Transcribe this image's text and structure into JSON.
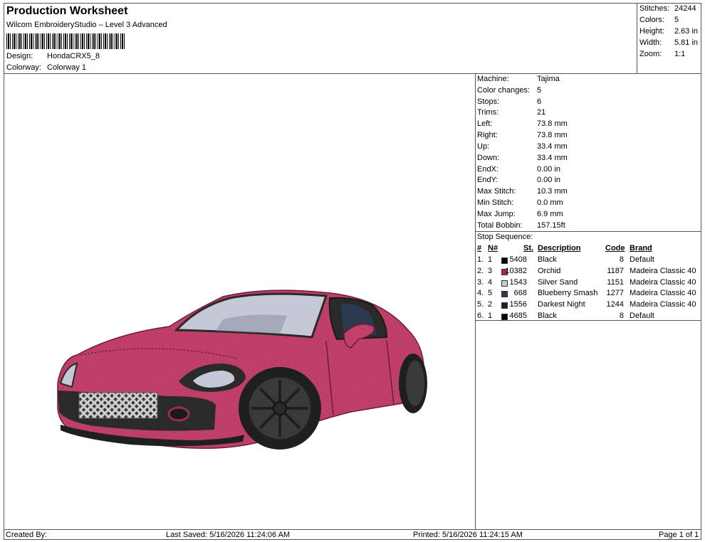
{
  "header": {
    "title": "Production Worksheet",
    "subtitle": "Wilcom EmbroideryStudio – Level 3 Advanced",
    "design_label": "Design:",
    "design_value": "HondaCRX5_8",
    "colorway_label": "Colorway:",
    "colorway_value": "Colorway 1"
  },
  "stats": [
    {
      "label": "Stitches:",
      "value": "24244"
    },
    {
      "label": "Colors:",
      "value": "5"
    },
    {
      "label": "Height:",
      "value": "2.63 in"
    },
    {
      "label": "Width:",
      "value": "5.81 in"
    },
    {
      "label": "Zoom:",
      "value": "1:1"
    }
  ],
  "machine": [
    {
      "label": "Machine:",
      "value": "Tajima"
    },
    {
      "label": "Color changes:",
      "value": "5"
    },
    {
      "label": "Stops:",
      "value": "6"
    },
    {
      "label": "Trims:",
      "value": "21"
    },
    {
      "label": "Left:",
      "value": "73.8 mm"
    },
    {
      "label": "Right:",
      "value": "73.8 mm"
    },
    {
      "label": "Up:",
      "value": "33.4 mm"
    },
    {
      "label": "Down:",
      "value": "33.4 mm"
    },
    {
      "label": "EndX:",
      "value": "0.00 in"
    },
    {
      "label": "EndY:",
      "value": "0.00 in"
    },
    {
      "label": "Max Stitch:",
      "value": "10.3 mm"
    },
    {
      "label": "Min Stitch:",
      "value": "0.0 mm"
    },
    {
      "label": "Max Jump:",
      "value": "6.9 mm"
    },
    {
      "label": "Total Bobbin:",
      "value": "157.15ft"
    }
  ],
  "stop_sequence": {
    "title": "Stop Sequence:",
    "headers": {
      "num": "#",
      "n": "N#",
      "st": "St.",
      "desc": "Description",
      "code": "Code",
      "brand": "Brand"
    },
    "rows": [
      {
        "num": "1.",
        "n": "1",
        "color": "#000000",
        "st": "5408",
        "desc": "Black",
        "code": "8",
        "brand": "Default"
      },
      {
        "num": "2.",
        "n": "3",
        "color": "#b2244f",
        "st": "10382",
        "desc": "Orchid",
        "code": "1187",
        "brand": "Madeira Classic 40"
      },
      {
        "num": "3.",
        "n": "4",
        "color": "#c5c8d6",
        "st": "1543",
        "desc": "Silver Sand",
        "code": "1151",
        "brand": "Madeira Classic 40"
      },
      {
        "num": "4.",
        "n": "5",
        "color": "#2a3a4f",
        "st": "668",
        "desc": "Blueberry Smash",
        "code": "1277",
        "brand": "Madeira Classic 40"
      },
      {
        "num": "5.",
        "n": "2",
        "color": "#222222",
        "st": "1556",
        "desc": "Darkest Night",
        "code": "1244",
        "brand": "Madeira Classic 40"
      },
      {
        "num": "6.",
        "n": "1",
        "color": "#000000",
        "st": "4685",
        "desc": "Black",
        "code": "8",
        "brand": "Default"
      }
    ]
  },
  "footer": {
    "created_by": "Created By:",
    "last_saved": "Last Saved: 5/16/2026 11:24:06 AM",
    "printed": "Printed: 5/16/2026 11:24:15 AM",
    "page": "Page 1 of 1"
  },
  "design_colors": {
    "body": "#c2416b",
    "body_dark": "#9c2d52",
    "glass": "#c5c8d6",
    "dark": "#2a2a2a",
    "navy": "#2a3a4f"
  }
}
